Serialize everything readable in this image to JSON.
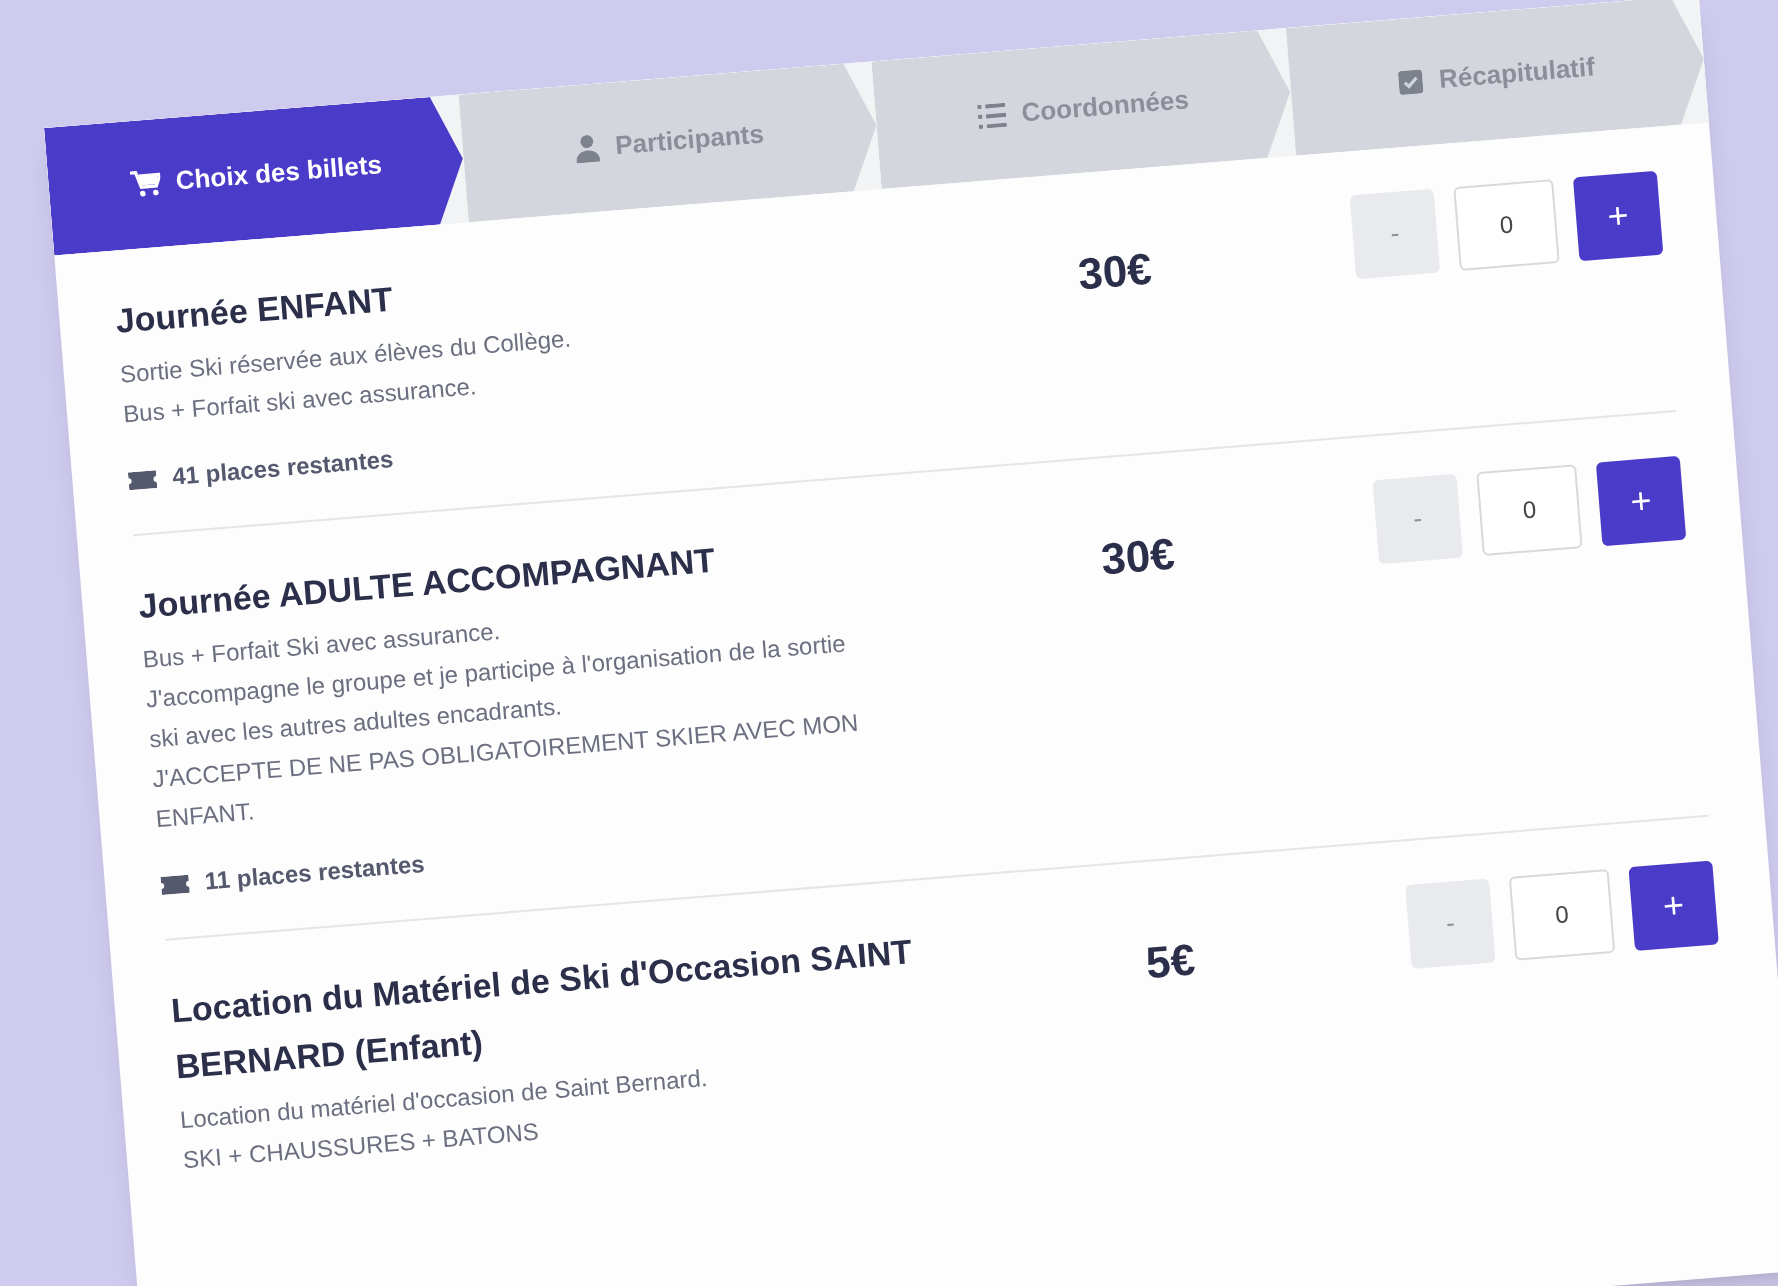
{
  "steps": [
    {
      "label": "Choix des billets",
      "kind": "cart",
      "selected": true
    },
    {
      "label": "Participants",
      "kind": "user",
      "selected": false
    },
    {
      "label": "Coordonnées",
      "kind": "list",
      "selected": false
    },
    {
      "label": "Récapitulatif",
      "kind": "check",
      "selected": false
    }
  ],
  "tickets": [
    {
      "title": "Journée ENFANT",
      "lines": [
        "Sortie Ski réservée aux élèves du Collège.",
        "Bus + Forfait ski avec assurance."
      ],
      "places": "41 places restantes",
      "price": "30€",
      "minus": "-",
      "quantity": "0",
      "plus": "+"
    },
    {
      "title": "Journée ADULTE ACCOMPAGNANT",
      "lines": [
        "Bus + Forfait Ski avec assurance.",
        "J'accompagne le groupe et je participe à l'organisation de la sortie",
        "ski avec les autres adultes encadrants.",
        "J'ACCEPTE DE NE PAS OBLIGATOIREMENT SKIER AVEC MON",
        "ENFANT."
      ],
      "places": "11 places restantes",
      "price": "30€",
      "minus": "-",
      "quantity": "0",
      "plus": "+"
    },
    {
      "title": "Location du Matériel de Ski d'Occasion SAINT BERNARD (Enfant)",
      "lines": [
        "Location du matériel d'occasion de Saint Bernard.",
        "SKI + CHAUSSURES + BATONS"
      ],
      "price": "5€",
      "minus": "-",
      "quantity": "0",
      "plus": "+"
    }
  ]
}
